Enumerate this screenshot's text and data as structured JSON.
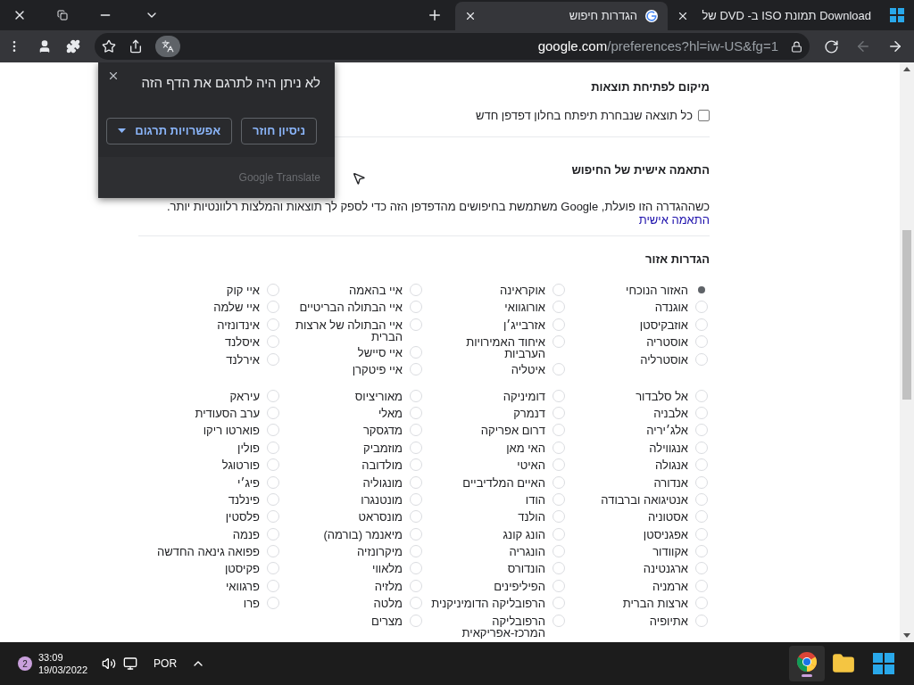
{
  "browser": {
    "tabs": [
      {
        "title": "Download תמונת ISO ב- DVD של",
        "selected": false
      },
      {
        "title": "הגדרות חיפוש",
        "selected": true
      }
    ],
    "address": {
      "host": "google.com",
      "path": "/preferences?hl=iw-US&fg=1"
    }
  },
  "translate_popup": {
    "title": "לא ניתן היה לתרגם את הדף הזה",
    "buttons": [
      {
        "label": "ניסיון חוזר",
        "kind": "plain"
      },
      {
        "label": "אפשרויות תרגום",
        "kind": "menu"
      }
    ],
    "footer": "Google Translate"
  },
  "results_location": {
    "heading": "מיקום לפתיחת תוצאות",
    "checkbox": {
      "label": "כל תוצאה שנבחרת תיפתח בחלון דפדפן חדש",
      "checked": false
    }
  },
  "personalization": {
    "heading": "התאמה אישית של החיפוש",
    "text": "כשההגדרה הזו פועלת, Google משתמשת בחיפושים מהדפדפן הזה כדי לספק לך תוצאות והמלצות רלוונטיות יותר.",
    "link": "התאמה אישית"
  },
  "region": {
    "heading": "הגדרות אזור",
    "blocks": [
      {
        "columns": [
          [
            {
              "label": "האזור הנוכחי",
              "selected": true
            },
            {
              "label": "אוגנדה",
              "selected": false
            },
            {
              "label": "אוזבקיסטן",
              "selected": false
            },
            {
              "label": "אוסטריה",
              "selected": false
            },
            {
              "label": "אוסטרליה",
              "selected": false
            }
          ],
          [
            {
              "label": "אוקראינה",
              "selected": false
            },
            {
              "label": "אורוגוואי",
              "selected": false
            },
            {
              "label": "אזרבייג׳ן",
              "selected": false
            },
            {
              "label": "איחוד האמירויות הערביות",
              "selected": false
            },
            {
              "label": "איטליה",
              "selected": false
            }
          ],
          [
            {
              "label": "איי בהאמה",
              "selected": false
            },
            {
              "label": "איי הבתולה הבריטיים",
              "selected": false
            },
            {
              "label": "איי הבתולה של ארצות הברית",
              "selected": false
            },
            {
              "label": "איי סיישל",
              "selected": false
            },
            {
              "label": "איי פיטקרן",
              "selected": false
            }
          ],
          [
            {
              "label": "איי קוק",
              "selected": false
            },
            {
              "label": "איי שלמה",
              "selected": false
            },
            {
              "label": "אינדונזיה",
              "selected": false
            },
            {
              "label": "איסלנד",
              "selected": false
            },
            {
              "label": "אירלנד",
              "selected": false
            }
          ]
        ]
      },
      {
        "columns": [
          [
            {
              "label": "אל סלבדור",
              "selected": false
            },
            {
              "label": "אלבניה",
              "selected": false
            },
            {
              "label": "אלג׳יריה",
              "selected": false
            },
            {
              "label": "אנגווילה",
              "selected": false
            },
            {
              "label": "אנגולה",
              "selected": false
            },
            {
              "label": "אנדורה",
              "selected": false
            },
            {
              "label": "אנטיגואה וברבודה",
              "selected": false
            },
            {
              "label": "אסטוניה",
              "selected": false
            },
            {
              "label": "אפגניסטן",
              "selected": false
            },
            {
              "label": "אקוודור",
              "selected": false
            },
            {
              "label": "ארגנטינה",
              "selected": false
            },
            {
              "label": "ארמניה",
              "selected": false
            },
            {
              "label": "ארצות הברית",
              "selected": false
            },
            {
              "label": "אתיופיה",
              "selected": false
            }
          ],
          [
            {
              "label": "דומיניקה",
              "selected": false
            },
            {
              "label": "דנמרק",
              "selected": false
            },
            {
              "label": "דרום אפריקה",
              "selected": false
            },
            {
              "label": "האי מאן",
              "selected": false
            },
            {
              "label": "האיטי",
              "selected": false
            },
            {
              "label": "האיים המלדיביים",
              "selected": false
            },
            {
              "label": "הודו",
              "selected": false
            },
            {
              "label": "הולנד",
              "selected": false
            },
            {
              "label": "הונג קונג",
              "selected": false
            },
            {
              "label": "הונגריה",
              "selected": false
            },
            {
              "label": "הונדורס",
              "selected": false
            },
            {
              "label": "הפיליפינים",
              "selected": false
            },
            {
              "label": "הרפובליקה הדומיניקנית",
              "selected": false
            },
            {
              "label": "הרפובליקה המרכז-אפריקאית",
              "selected": false
            }
          ],
          [
            {
              "label": "מאוריציוס",
              "selected": false
            },
            {
              "label": "מאלי",
              "selected": false
            },
            {
              "label": "מדגסקר",
              "selected": false
            },
            {
              "label": "מוזמביק",
              "selected": false
            },
            {
              "label": "מולדובה",
              "selected": false
            },
            {
              "label": "מונגוליה",
              "selected": false
            },
            {
              "label": "מונטנגרו",
              "selected": false
            },
            {
              "label": "מונסראט",
              "selected": false
            },
            {
              "label": "מיאנמר (בורמה)",
              "selected": false
            },
            {
              "label": "מיקרונזיה",
              "selected": false
            },
            {
              "label": "מלאווי",
              "selected": false
            },
            {
              "label": "מלזיה",
              "selected": false
            },
            {
              "label": "מלטה",
              "selected": false
            },
            {
              "label": "מצרים",
              "selected": false
            }
          ],
          [
            {
              "label": "עיראק",
              "selected": false
            },
            {
              "label": "ערב הסעודית",
              "selected": false
            },
            {
              "label": "פוארטו ריקו",
              "selected": false
            },
            {
              "label": "פולין",
              "selected": false
            },
            {
              "label": "פורטוגל",
              "selected": false
            },
            {
              "label": "פיג׳י",
              "selected": false
            },
            {
              "label": "פינלנד",
              "selected": false
            },
            {
              "label": "פלסטין",
              "selected": false
            },
            {
              "label": "פנמה",
              "selected": false
            },
            {
              "label": "פפואה גינאה החדשה",
              "selected": false
            },
            {
              "label": "פקיסטן",
              "selected": false
            },
            {
              "label": "פרגוואי",
              "selected": false
            },
            {
              "label": "פרו",
              "selected": false
            }
          ]
        ]
      }
    ]
  },
  "taskbar": {
    "notifications": "2",
    "time": "33:09",
    "date": "19/03/2022",
    "language": "POR"
  }
}
